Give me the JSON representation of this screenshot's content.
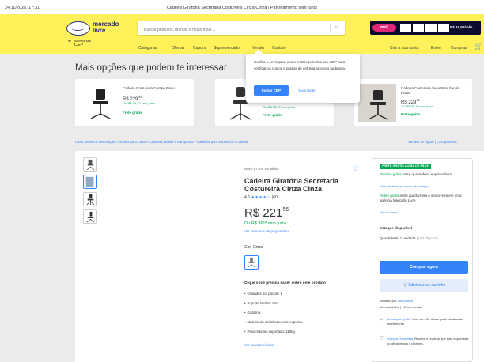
{
  "print_header": {
    "date": "24/11/2025, 17:31",
    "title": "Cadeira Giratória Secretaria Costureira Cinza Cinza | Parcelamento sem juros"
  },
  "header": {
    "logo_line1": "mercado",
    "logo_line2": "livre",
    "search_placeholder": "Buscar produtos, marcas e muito mais…",
    "promo_pill": "meli",
    "promo_text": "R$ 19,90/mês",
    "cep_label": "Informe seu",
    "cep_value": "CEP",
    "nav": [
      "Categorias",
      "Ofertas",
      "Cupons",
      "Supermercado",
      "Vender",
      "Contato"
    ],
    "nav_right": [
      "Crie a sua conta",
      "Entre",
      "Compras"
    ]
  },
  "recommendations": {
    "title": "Mais opções que podem te interessar",
    "items": [
      {
        "title": "Cadeira Costureira Corapo Preto",
        "price": "R$ 229",
        "price_cents": "90",
        "installments": "Ou R$ 38,32 sem juros",
        "shipping": "Frete grátis"
      },
      {
        "title": "",
        "price": "R$ 214",
        "price_cents": "",
        "installments": "Ou R$ 35,67 sem juros",
        "shipping": "Frete grátis"
      },
      {
        "title": "Cadeira Costureira Secretaria Sacola Preta",
        "price": "R$ 229",
        "price_cents": "90",
        "installments": "Ou R$ 38,32 sem juros",
        "shipping": "Frete grátis"
      }
    ]
  },
  "popover": {
    "text": "Confira o envio para o seu endereço Inclua seu CEP para verificar os custos e prazos de entrega precisos na busca.",
    "primary": "Incluir CEP",
    "secondary": "Mais tarde"
  },
  "breadcrumb": "Casa, Móveis e Decoração > Móveis para Casa > Cadeiras, Bebês e Banquetas > Cadeiras para Escritório > Cadeira",
  "breadcrumb_right": "Vender um igual | Compartilhar",
  "product": {
    "condition": "Novo | +100 vendidos",
    "title": "Cadeira Giratória Secretaria Costureira Cinza Cinza",
    "rating": "4.6",
    "stars": "★★★★☆",
    "reviews": "(60)",
    "price_main": "R$ 221",
    "price_cents": "56",
    "installments": "Ou R$ 36⁹⁰ sem juros",
    "payment_link": "Ver os meios de pagamento",
    "color_label": "Cor: Cinza",
    "features_title": "O que você precisa saber sobre este produto",
    "features": [
      "Unidades por pacote: 1",
      "Suporte lombar: Sim.",
      "Giratória.",
      "Material do acolchoamento: espuma.",
      "Peso máximo suportado: 110kg."
    ],
    "features_link": "Ver características"
  },
  "buybox": {
    "badge": "FRETE GRÁTIS ACIMA DE R$ 19",
    "ship_free": "Receba grátis",
    "ship_text": " entre quarta-feira e quinta-feira",
    "ship_link": "Mais detalhes e formas de entrega",
    "pickup_free": "Retire grátis",
    "pickup_text": " entre quarta-feira e sexta-feira em uma agência Mercado Livre",
    "pickup_link": "Ver no mapa",
    "stock": "Estoque disponível",
    "quantity": "Quantidade: 1 unidade",
    "quantity_avail": "(+50 disponív...",
    "buy": "Comprar agora",
    "add_cart": "Adicionar ao carrinho",
    "sold_by": "Vendido por",
    "seller": "urbanoffice",
    "seller_sub": "MercadoLíder | +10mil vendas",
    "return_link": "Devolução grátis",
    "return_text": ". Você tem 30 dias a partir da data de recebimento.",
    "guarantee_link": "Compra Garantida",
    "guarantee_text": ", Receba o produto que está esperando ou devolvemos o dinheiro."
  }
}
